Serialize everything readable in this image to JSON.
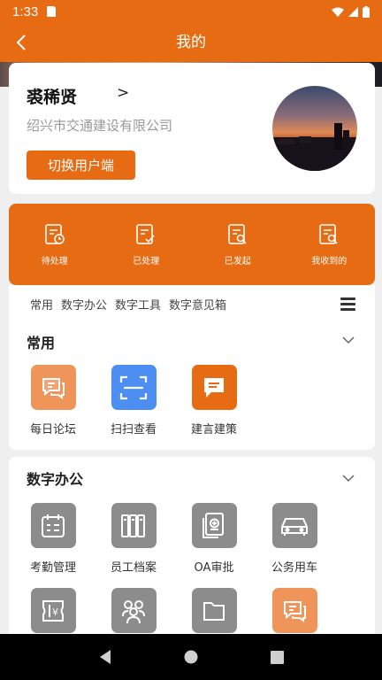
{
  "status_bar": {
    "time": "1:33"
  },
  "app_bar": {
    "title": "我的"
  },
  "profile": {
    "name": "裘稀贤",
    "arrow": ">",
    "company": "绍兴市交通建设有限公司",
    "switch_button": "切换用户端"
  },
  "tasks": [
    {
      "label": "待处理",
      "icon": "pending-doc-icon"
    },
    {
      "label": "已处理",
      "icon": "done-doc-icon"
    },
    {
      "label": "已发起",
      "icon": "initiated-doc-icon"
    },
    {
      "label": "我收到的",
      "icon": "received-doc-icon"
    }
  ],
  "tabs": [
    "常用",
    "数字办公",
    "数字工具",
    "数字意见箱"
  ],
  "common": {
    "title": "常用",
    "items": [
      {
        "label": "每日论坛",
        "icon": "forum-chat-icon",
        "color": "#f0955a"
      },
      {
        "label": "扫扫查看",
        "icon": "scan-icon",
        "color": "#4d8ef2"
      },
      {
        "label": "建言建策",
        "icon": "suggestion-chat-icon",
        "color": "#e66b12"
      }
    ]
  },
  "office": {
    "title": "数字办公",
    "items": [
      {
        "label": "考勤管理",
        "icon": "calendar-icon",
        "color": "#8c8c8c"
      },
      {
        "label": "员工档案",
        "icon": "files-icon",
        "color": "#8c8c8c"
      },
      {
        "label": "OA审批",
        "icon": "approval-doc-icon",
        "color": "#8c8c8c"
      },
      {
        "label": "公务用车",
        "icon": "car-icon",
        "color": "#8c8c8c"
      },
      {
        "label": "",
        "icon": "invoice-icon",
        "color": "#8c8c8c"
      },
      {
        "label": "",
        "icon": "group-icon",
        "color": "#8c8c8c"
      },
      {
        "label": "",
        "icon": "folder-icon",
        "color": "#8c8c8c"
      },
      {
        "label": "",
        "icon": "chat-icon",
        "color": "#f0955a"
      }
    ]
  },
  "colors": {
    "brand": "#e66b12",
    "background": "#efefef"
  }
}
